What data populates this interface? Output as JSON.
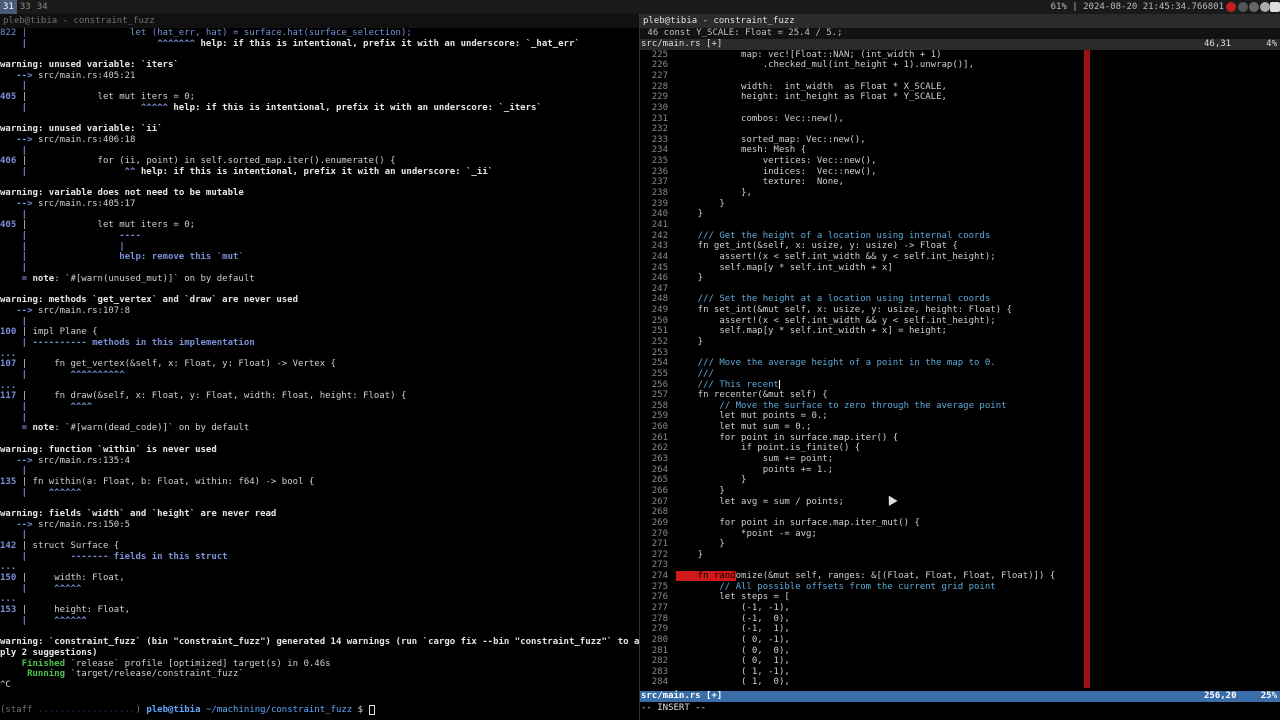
{
  "topbar": {
    "workspaces": [
      "31",
      "33",
      "34"
    ],
    "status": "61% | 2024-08-20 21:45:34.766801",
    "tray_icons": [
      "record-icon",
      "clock-icon",
      "globe-icon",
      "gear-icon",
      "home-icon"
    ]
  },
  "left_terminal": {
    "title": "pleb@tibia - constraint_fuzz",
    "lines": [
      [
        [
          "822 |                   let (hat_err, hat) = surface.hat(surface_selection);",
          "bl"
        ]
      ],
      [
        [
          "    |                        ^^^^^^^ ",
          "bb"
        ],
        [
          "help: if this is intentional, prefix it with an underscore: `_hat_err`",
          "hl"
        ]
      ],
      [
        [
          "",
          ""
        ]
      ],
      [
        [
          "warning",
          "w"
        ],
        [
          ": unused variable: `iters`",
          "hl"
        ]
      ],
      [
        [
          "   --> ",
          "bb"
        ],
        [
          "src/main.rs:405:21",
          ""
        ]
      ],
      [
        [
          "    |",
          "bb"
        ]
      ],
      [
        [
          "405 ",
          "bb"
        ],
        [
          "|             let mut iters = 0;",
          ""
        ]
      ],
      [
        [
          "    |                     ^^^^^ ",
          "bb"
        ],
        [
          "help: if this is intentional, prefix it with an underscore: `_iters`",
          "hl"
        ]
      ],
      [
        [
          "",
          ""
        ]
      ],
      [
        [
          "warning",
          "w"
        ],
        [
          ": unused variable: `ii`",
          "hl"
        ]
      ],
      [
        [
          "   --> ",
          "bb"
        ],
        [
          "src/main.rs:406:18",
          ""
        ]
      ],
      [
        [
          "    |",
          "bb"
        ]
      ],
      [
        [
          "406 ",
          "bb"
        ],
        [
          "|             for (ii, point) in self.sorted_map.iter().enumerate() {",
          ""
        ]
      ],
      [
        [
          "    |                  ^^ ",
          "bb"
        ],
        [
          "help: if this is intentional, prefix it with an underscore: `_ii`",
          "hl"
        ]
      ],
      [
        [
          "",
          ""
        ]
      ],
      [
        [
          "warning",
          "w"
        ],
        [
          ": variable does not need to be mutable",
          "hl"
        ]
      ],
      [
        [
          "   --> ",
          "bb"
        ],
        [
          "src/main.rs:405:17",
          ""
        ]
      ],
      [
        [
          "    |",
          "bb"
        ]
      ],
      [
        [
          "405 ",
          "bb"
        ],
        [
          "|             let mut iters = 0;",
          ""
        ]
      ],
      [
        [
          "    |                 ----",
          "bb"
        ]
      ],
      [
        [
          "    |                 |",
          "bb"
        ]
      ],
      [
        [
          "    |                 help: remove this `mut`",
          "bb"
        ]
      ],
      [
        [
          "    |",
          "bb"
        ]
      ],
      [
        [
          "    = ",
          "bb"
        ],
        [
          "note",
          "hl"
        ],
        [
          ": `#[warn(unused_mut)]` on by default",
          ""
        ]
      ],
      [
        [
          "",
          ""
        ]
      ],
      [
        [
          "warning",
          "w"
        ],
        [
          ": methods `get_vertex` and `draw` are never used",
          "hl"
        ]
      ],
      [
        [
          "   --> ",
          "bb"
        ],
        [
          "src/main.rs:107:8",
          ""
        ]
      ],
      [
        [
          "    |",
          "bb"
        ]
      ],
      [
        [
          "100 ",
          "bb"
        ],
        [
          "| impl Plane {",
          ""
        ]
      ],
      [
        [
          "    | ---------- ",
          "bb"
        ],
        [
          "methods in this implementation",
          "bb"
        ]
      ],
      [
        [
          "...",
          "bb"
        ]
      ],
      [
        [
          "107 ",
          "bb"
        ],
        [
          "|     fn get_vertex(&self, x: Float, y: Float) -> Vertex {",
          ""
        ]
      ],
      [
        [
          "    |        ^^^^^^^^^^",
          "bb"
        ]
      ],
      [
        [
          "...",
          "bb"
        ]
      ],
      [
        [
          "117 ",
          "bb"
        ],
        [
          "|     fn draw(&self, x: Float, y: Float, width: Float, height: Float) {",
          ""
        ]
      ],
      [
        [
          "    |        ^^^^",
          "bb"
        ]
      ],
      [
        [
          "    |",
          "bb"
        ]
      ],
      [
        [
          "    = ",
          "bb"
        ],
        [
          "note",
          "hl"
        ],
        [
          ": `#[warn(dead_code)]` on by default",
          ""
        ]
      ],
      [
        [
          "",
          ""
        ]
      ],
      [
        [
          "warning",
          "w"
        ],
        [
          ": function `within` is never used",
          "hl"
        ]
      ],
      [
        [
          "   --> ",
          "bb"
        ],
        [
          "src/main.rs:135:4",
          ""
        ]
      ],
      [
        [
          "    |",
          "bb"
        ]
      ],
      [
        [
          "135 ",
          "bb"
        ],
        [
          "| fn within(a: Float, b: Float, within: f64) -> bool {",
          ""
        ]
      ],
      [
        [
          "    |    ^^^^^^",
          "bb"
        ]
      ],
      [
        [
          "",
          ""
        ]
      ],
      [
        [
          "warning",
          "w"
        ],
        [
          ": fields `width` and `height` are never read",
          "hl"
        ]
      ],
      [
        [
          "   --> ",
          "bb"
        ],
        [
          "src/main.rs:150:5",
          ""
        ]
      ],
      [
        [
          "    |",
          "bb"
        ]
      ],
      [
        [
          "142 ",
          "bb"
        ],
        [
          "| struct Surface {",
          ""
        ]
      ],
      [
        [
          "    |        ------- ",
          "bb"
        ],
        [
          "fields in this struct",
          "bb"
        ]
      ],
      [
        [
          "...",
          "bb"
        ]
      ],
      [
        [
          "150 ",
          "bb"
        ],
        [
          "|     width: Float,",
          ""
        ]
      ],
      [
        [
          "    |     ^^^^^",
          "bb"
        ]
      ],
      [
        [
          "...",
          "bb"
        ]
      ],
      [
        [
          "153 ",
          "bb"
        ],
        [
          "|     height: Float,",
          ""
        ]
      ],
      [
        [
          "    |     ^^^^^^",
          "bb"
        ]
      ],
      [
        [
          "",
          ""
        ]
      ],
      [
        [
          "warning",
          "w"
        ],
        [
          ": `constraint_fuzz` (bin \"constraint_fuzz\") generated 14 warnings (run `cargo fix --bin \"constraint_fuzz\"` to ap",
          "hl"
        ]
      ],
      [
        [
          "ply 2 suggestions)",
          "hl"
        ]
      ],
      [
        [
          "    Finished",
          "gr"
        ],
        [
          " `release` profile [optimized] target(s) in 0.46s",
          ""
        ]
      ],
      [
        [
          "     Running",
          "gr"
        ],
        [
          " `target/release/constraint_fuzz`",
          ""
        ]
      ],
      [
        [
          "^C",
          ""
        ]
      ]
    ],
    "prompt": {
      "prefix": "(staff ",
      "hidden": "..................",
      "user_host": "pleb@tibia",
      "path": "~/machining/constraint_fuzz",
      "symbol": "$"
    }
  },
  "vim": {
    "title": "pleb@tibia - constraint_fuzz",
    "context_line": " 46 const Y_SCALE: Float = 25.4 / 5.;",
    "top_status": {
      "file": "src/main.rs [+]",
      "position": "46,31",
      "percent": "4%"
    },
    "lines": [
      {
        "n": "225",
        "t": "            map: vec![Float::NAN; (int_width + 1)"
      },
      {
        "n": "226",
        "t": "                .checked_mul(int_height + 1).unwrap()],"
      },
      {
        "n": "227",
        "t": ""
      },
      {
        "n": "228",
        "t": "            width:  int_width  as Float * X_SCALE,"
      },
      {
        "n": "229",
        "t": "            height: int_height as Float * Y_SCALE,"
      },
      {
        "n": "230",
        "t": ""
      },
      {
        "n": "231",
        "t": "            combos: Vec::new(),"
      },
      {
        "n": "232",
        "t": ""
      },
      {
        "n": "233",
        "t": "            sorted_map: Vec::new(),"
      },
      {
        "n": "234",
        "t": "            mesh: Mesh {"
      },
      {
        "n": "235",
        "t": "                vertices: Vec::new(),"
      },
      {
        "n": "236",
        "t": "                indices:  Vec::new(),"
      },
      {
        "n": "237",
        "t": "                texture:  None,"
      },
      {
        "n": "238",
        "t": "            },"
      },
      {
        "n": "239",
        "t": "        }"
      },
      {
        "n": "240",
        "t": "    }"
      },
      {
        "n": "241",
        "t": ""
      },
      {
        "n": "242",
        "t": "    /// Get the height of a location using internal coords",
        "c": true
      },
      {
        "n": "243",
        "t": "    fn get_int(&self, x: usize, y: usize) -> Float {"
      },
      {
        "n": "244",
        "t": "        assert!(x < self.int_width && y < self.int_height);"
      },
      {
        "n": "245",
        "t": "        self.map[y * self.int_width + x]"
      },
      {
        "n": "246",
        "t": "    }"
      },
      {
        "n": "247",
        "t": ""
      },
      {
        "n": "248",
        "t": "    /// Set the height at a location using internal coords",
        "c": true
      },
      {
        "n": "249",
        "t": "    fn set_int(&mut self, x: usize, y: usize, height: Float) {"
      },
      {
        "n": "250",
        "t": "        assert!(x < self.int_width && y < self.int_height);"
      },
      {
        "n": "251",
        "t": "        self.map[y * self.int_width + x] = height;"
      },
      {
        "n": "252",
        "t": "    }"
      },
      {
        "n": "253",
        "t": ""
      },
      {
        "n": "254",
        "t": "    /// Move the average height of a point in the map to 0.",
        "c": true
      },
      {
        "n": "255",
        "t": "    ///",
        "c": true
      },
      {
        "n": "256",
        "t": "    /// This recent",
        "c": true,
        "cursor": true
      },
      {
        "n": "257",
        "t": "    fn recenter(&mut self) {"
      },
      {
        "n": "258",
        "t": "        // Move the surface to zero through the average point",
        "c": true
      },
      {
        "n": "259",
        "t": "        let mut points = 0.;"
      },
      {
        "n": "260",
        "t": "        let mut sum = 0.;"
      },
      {
        "n": "261",
        "t": "        for point in surface.map.iter() {"
      },
      {
        "n": "262",
        "t": "            if point.is_finite() {"
      },
      {
        "n": "263",
        "t": "                sum += point;"
      },
      {
        "n": "264",
        "t": "                points += 1.;"
      },
      {
        "n": "265",
        "t": "            }"
      },
      {
        "n": "266",
        "t": "        }"
      },
      {
        "n": "267",
        "t": "        let avg = sum / points;"
      },
      {
        "n": "268",
        "t": ""
      },
      {
        "n": "269",
        "t": "        for point in surface.map.iter_mut() {"
      },
      {
        "n": "270",
        "t": "            *point -= avg;"
      },
      {
        "n": "271",
        "t": "        }"
      },
      {
        "n": "272",
        "t": "    }"
      },
      {
        "n": "273",
        "t": ""
      },
      {
        "n": "274",
        "t": "omize(&mut self, ranges: &[(Float, Float, Float, Float)]) {",
        "err": "    fn rand"
      },
      {
        "n": "275",
        "t": "        // All possible offsets from the current grid point",
        "c": true
      },
      {
        "n": "276",
        "t": "        let steps = ["
      },
      {
        "n": "277",
        "t": "            (-1, -1),"
      },
      {
        "n": "278",
        "t": "            (-1,  0),"
      },
      {
        "n": "279",
        "t": "            (-1,  1),"
      },
      {
        "n": "280",
        "t": "            ( 0, -1),"
      },
      {
        "n": "281",
        "t": "            ( 0,  0),"
      },
      {
        "n": "282",
        "t": "            ( 0,  1),"
      },
      {
        "n": "283",
        "t": "            ( 1, -1),"
      },
      {
        "n": "284",
        "t": "            ( 1,  0),"
      }
    ],
    "bottom_status": {
      "file": "src/main.rs [+]",
      "position": "256,20",
      "percent": "25%"
    },
    "mode": "-- INSERT --"
  },
  "colors": {
    "colorcolumn": "#a01010",
    "statusline": "#3a6ea8",
    "comment": "#5fa8d8",
    "error_bg": "#d01818"
  }
}
